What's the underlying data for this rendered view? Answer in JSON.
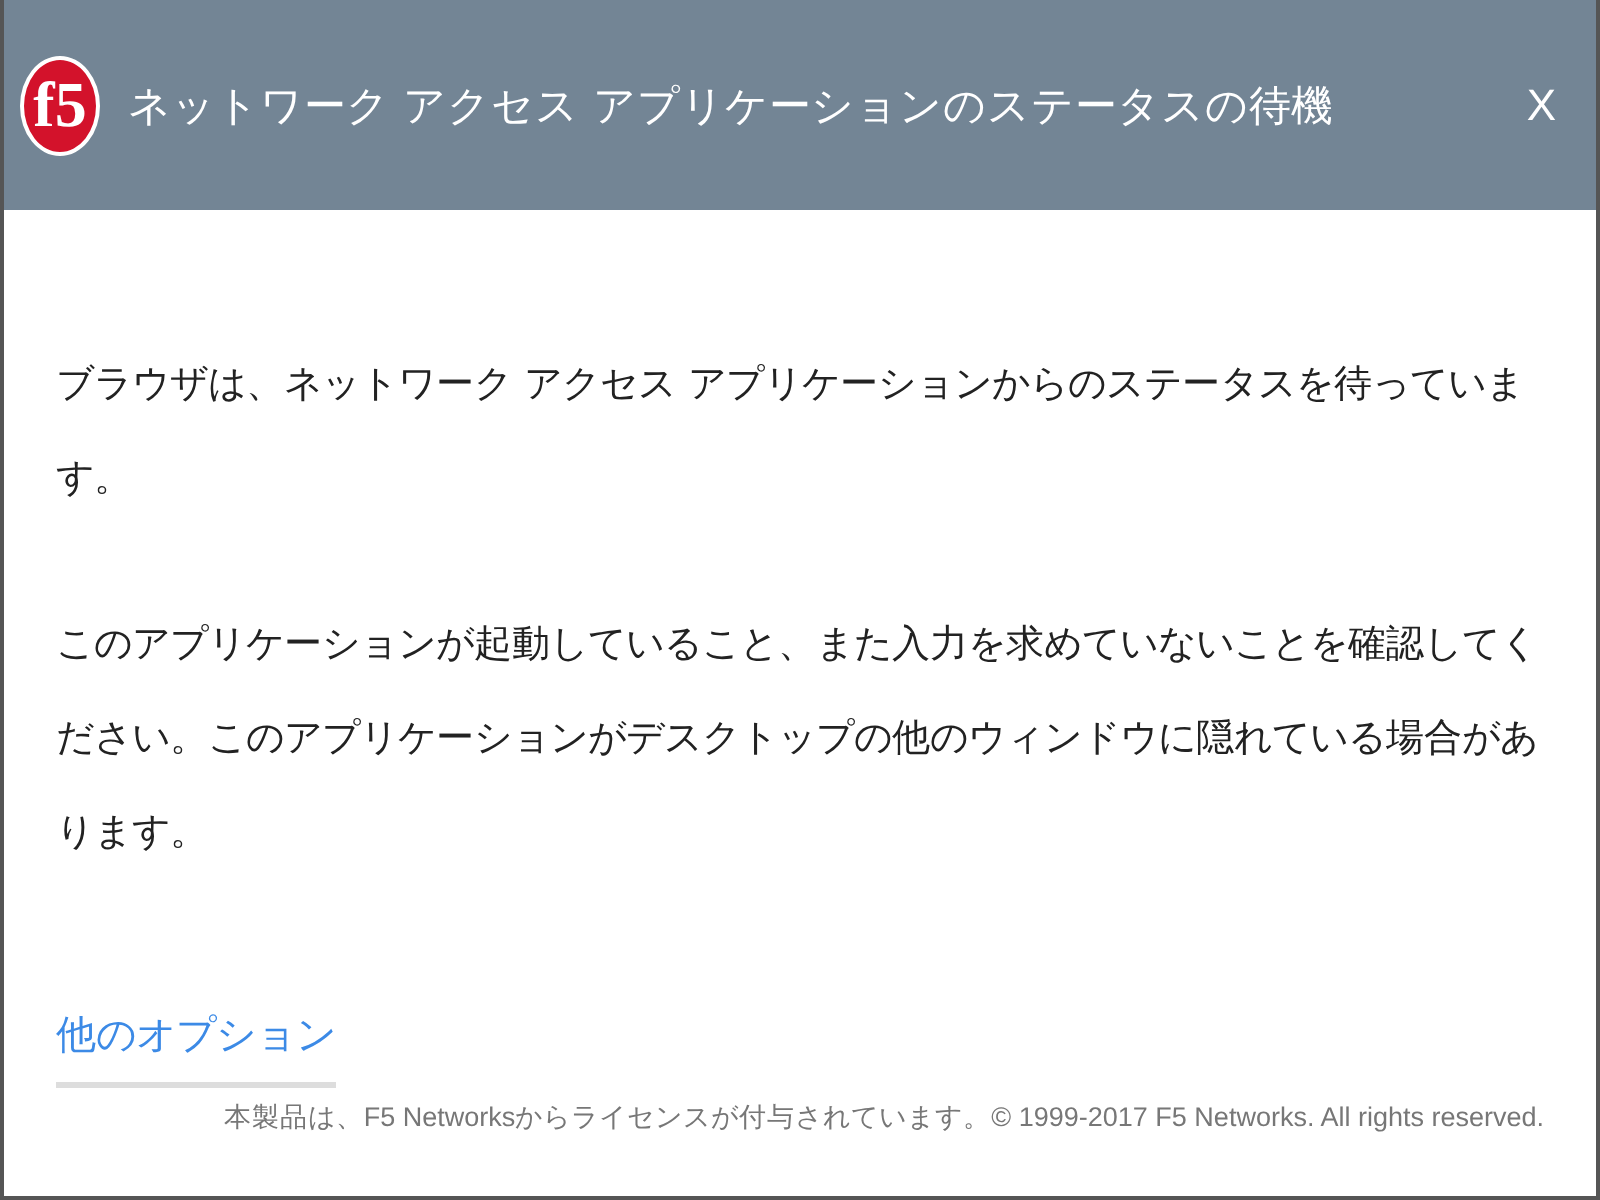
{
  "window": {
    "logo": "f5",
    "title": "ネットワーク アクセス アプリケーションのステータスの待機",
    "close": "X"
  },
  "messages": [
    "ブラウザは、ネットワーク アクセス アプリケーションからのステータスを待っています。",
    "このアプリケーションが起動していること、また入力を求めていないことを確認してください。このアプリケーションがデスクトップの他のウィンドウに隠れている場合があります。"
  ],
  "link": "他のオプション",
  "footer": "本製品は、F5 Networksからライセンスが付与されています。© 1999-2017 F5 Networks. All rights reserved."
}
